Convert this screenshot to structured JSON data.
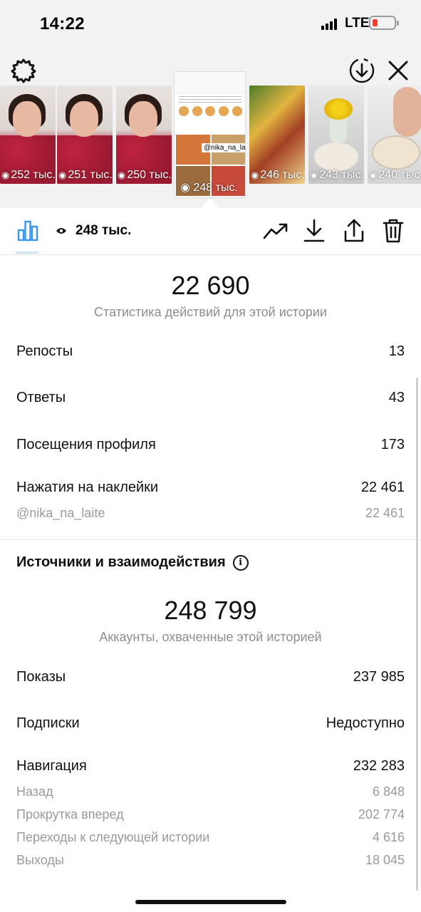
{
  "status_bar": {
    "time": "14:22",
    "network": "LTE"
  },
  "thumbnails": [
    {
      "views": "252 тыс."
    },
    {
      "views": "251 тыс."
    },
    {
      "views": "250 тыс."
    },
    {
      "views": "248 тыс.",
      "tag": "@nika_na_laite",
      "selected": true
    },
    {
      "views": "246 тыс."
    },
    {
      "views": "243 тыс."
    },
    {
      "views": "240 тыс."
    }
  ],
  "toolbar": {
    "views": "248 тыс."
  },
  "interactions": {
    "total": "22 690",
    "caption": "Статистика действий для этой истории",
    "rows": [
      {
        "label": "Репосты",
        "value": "13"
      },
      {
        "label": "Ответы",
        "value": "43"
      },
      {
        "label": "Посещения профиля",
        "value": "173"
      },
      {
        "label": "Нажатия на наклейки",
        "value": "22 461"
      }
    ],
    "sticker_row": {
      "label": "@nika_na_laite",
      "value": "22 461"
    }
  },
  "discovery": {
    "title": "Источники и взаимодействия",
    "info_icon": "info-icon",
    "total": "248 799",
    "caption": "Аккаунты, охваченные этой историей",
    "rows": [
      {
        "label": "Показы",
        "value": "237 985"
      },
      {
        "label": "Подписки",
        "value": "Недоступно"
      },
      {
        "label": "Навигация",
        "value": "232 283"
      }
    ],
    "navigation": [
      {
        "label": "Назад",
        "value": "6 848"
      },
      {
        "label": "Прокрутка вперед",
        "value": "202 774"
      },
      {
        "label": "Переходы к следующей истории",
        "value": "4 616"
      },
      {
        "label": "Выходы",
        "value": "18 045"
      }
    ]
  },
  "colors": {
    "battery_low": "#ff3b30",
    "muted_text": "#8e8e8e",
    "accent_tab": "#3897f0"
  }
}
